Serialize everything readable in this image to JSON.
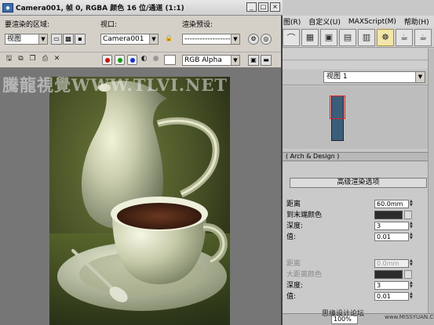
{
  "window": {
    "title": "Camera001, 帧 0, RGBA 颜色 16 位/通道 (1:1)",
    "buttons": [
      "_",
      "□",
      "×"
    ]
  },
  "controls": {
    "area_label": "要渲染的区域:",
    "area_value": "视图",
    "viewport_label": "视口:",
    "viewport_value": "Camera001",
    "preset_label": "渲染预设:",
    "preset_value": "---------------------",
    "channel_value": "RGB Alpha",
    "channel_colors": [
      "#cc1111",
      "#119911",
      "#1133cc"
    ]
  },
  "watermark": "騰龍視覺WWW.TLVI.NET",
  "background_app": {
    "menu": [
      "图(R)",
      "自定义(U)",
      "MAXScript(M)",
      "帮助(H)"
    ],
    "view_dropdown": "视图 1",
    "rollout_title": "( Arch & Design )",
    "panel_header": "高级渲染选项",
    "rows": [
      {
        "label": "距离",
        "value": "60.0mm",
        "dim": false,
        "kind": "spin"
      },
      {
        "label": "到末端颜色",
        "value": "",
        "dim": false,
        "kind": "color"
      },
      {
        "label": "深度:",
        "value": "3",
        "dim": false,
        "kind": "spin"
      },
      {
        "label": "值:",
        "value": "0.01",
        "dim": false,
        "kind": "spin"
      },
      {
        "label": "距离",
        "value": "0.0mm",
        "dim": true,
        "kind": "spin"
      },
      {
        "label": "大距离颜色",
        "value": "",
        "dim": true,
        "kind": "color"
      },
      {
        "label": "深度:",
        "value": "3",
        "dim": false,
        "kind": "spin"
      },
      {
        "label": "值:",
        "value": "0.01",
        "dim": false,
        "kind": "spin"
      }
    ],
    "zoom": "100%",
    "credit": "思缘设计论坛",
    "credit_url": "www.MISSYUAN.COM"
  }
}
